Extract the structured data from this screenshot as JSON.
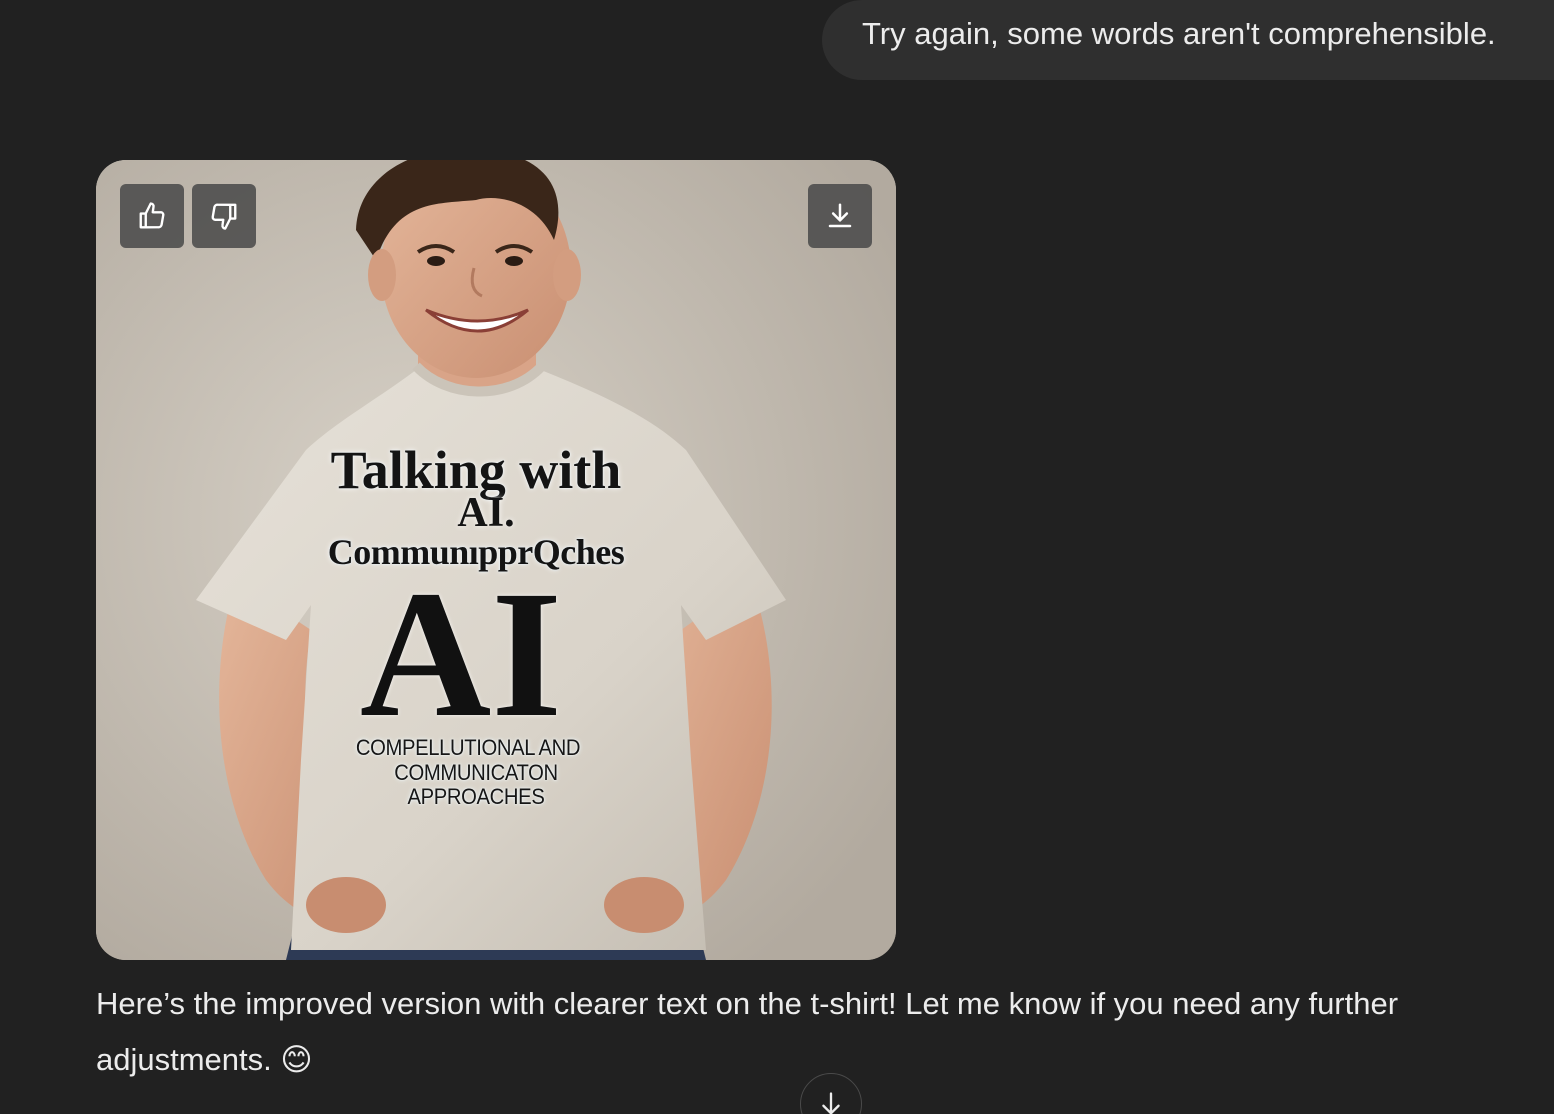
{
  "conversation": {
    "user_message": "Try again, some words aren't comprehensible.",
    "image": {
      "shirt_text": {
        "line1": "Talking with",
        "line2": "AI.",
        "line3": "CommunıpprQches",
        "big": "AI",
        "line5": "COMPELLUTIONAL AND",
        "line6": "COMMUNICATON APPROACHES"
      },
      "buttons": {
        "like_icon": "thumbs-up-icon",
        "dislike_icon": "thumbs-down-icon",
        "download_icon": "download-icon"
      }
    },
    "assistant_message": "Here’s the improved version with clearer text on the t-shirt! Let me know if you need any further adjustments. 😊"
  },
  "scroll_button": {
    "icon": "arrow-down-icon"
  },
  "colors": {
    "background": "#212121",
    "bubble": "#2f2f2f",
    "text": "#ececec"
  }
}
